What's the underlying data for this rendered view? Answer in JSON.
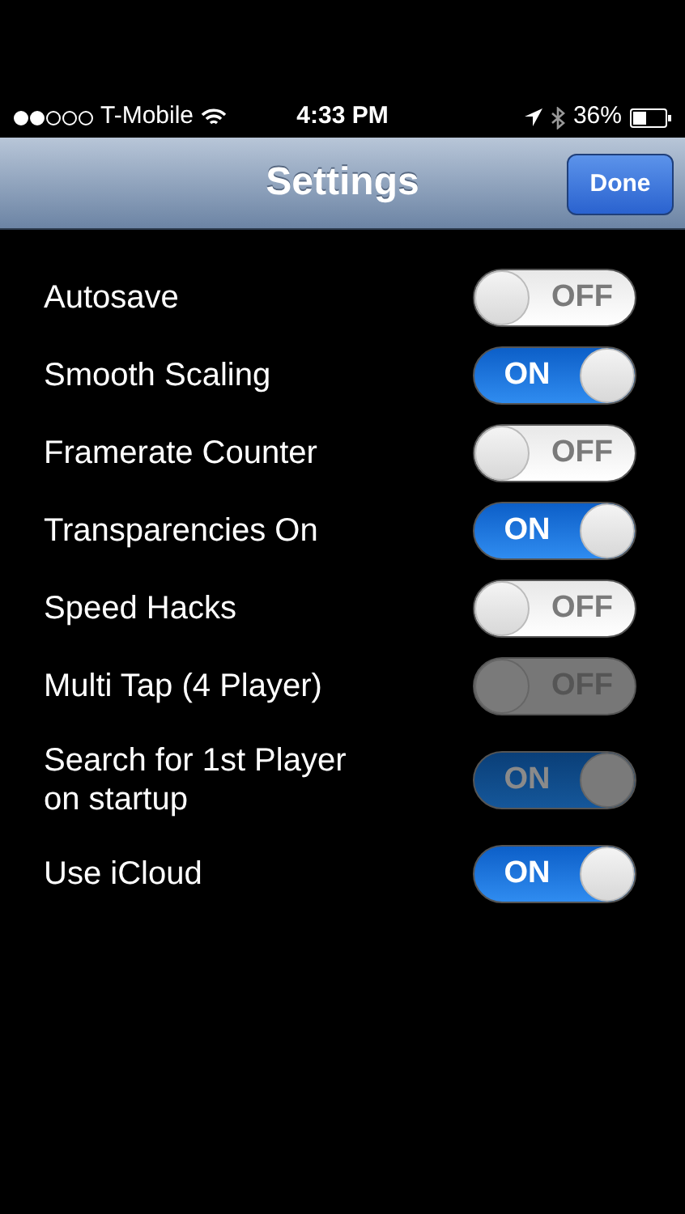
{
  "status_bar": {
    "carrier": "T-Mobile",
    "time": "4:33 PM",
    "battery": "36%"
  },
  "nav_bar": {
    "title": "Settings",
    "done": "Done"
  },
  "settings": [
    {
      "label": "Autosave",
      "on": false,
      "disabled": false,
      "switch_text": "OFF"
    },
    {
      "label": "Smooth Scaling",
      "on": true,
      "disabled": false,
      "switch_text": "ON"
    },
    {
      "label": "Framerate Counter",
      "on": false,
      "disabled": false,
      "switch_text": "OFF"
    },
    {
      "label": "Transparencies On",
      "on": true,
      "disabled": false,
      "switch_text": "ON"
    },
    {
      "label": "Speed Hacks",
      "on": false,
      "disabled": false,
      "switch_text": "OFF"
    },
    {
      "label": "Multi Tap (4 Player)",
      "on": false,
      "disabled": true,
      "switch_text": "OFF"
    },
    {
      "label": "Search for 1st Player on startup",
      "on": true,
      "disabled": true,
      "switch_text": "ON"
    },
    {
      "label": "Use iCloud",
      "on": true,
      "disabled": false,
      "switch_text": "ON"
    }
  ]
}
